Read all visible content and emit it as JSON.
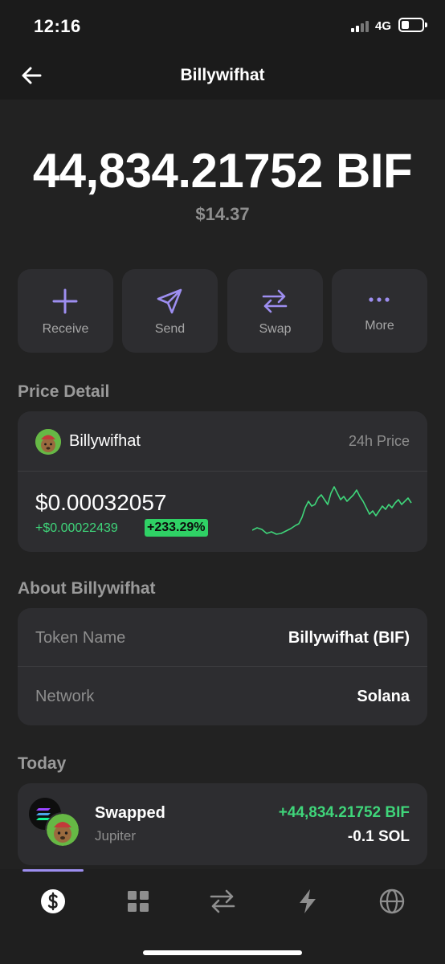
{
  "status_bar": {
    "time": "12:16",
    "network": "4G"
  },
  "header": {
    "title": "Billywifhat"
  },
  "balance": {
    "amount": "44,834.21752 BIF",
    "usd": "$14.37"
  },
  "actions": [
    {
      "label": "Receive",
      "icon": "plus-icon"
    },
    {
      "label": "Send",
      "icon": "send-icon"
    },
    {
      "label": "Swap",
      "icon": "swap-icon"
    },
    {
      "label": "More",
      "icon": "more-icon"
    }
  ],
  "price_detail": {
    "section_title": "Price Detail",
    "token_name": "Billywifhat",
    "period_label": "24h Price",
    "price": "$0.00032057",
    "change_abs": "+$0.00022439",
    "change_pct": "+233.29%"
  },
  "about": {
    "section_title": "About Billywifhat",
    "rows": [
      {
        "label": "Token Name",
        "value": "Billywifhat (BIF)"
      },
      {
        "label": "Network",
        "value": "Solana"
      }
    ]
  },
  "activity": {
    "section_title": "Today",
    "items": [
      {
        "title": "Swapped",
        "subtitle": "Jupiter",
        "amount_in": "+44,834.21752 BIF",
        "amount_out": "-0.1 SOL"
      }
    ]
  },
  "bottom_nav": {
    "items": [
      {
        "icon": "dollar-icon",
        "active": true
      },
      {
        "icon": "grid-icon",
        "active": false
      },
      {
        "icon": "swap-arrows-icon",
        "active": false
      },
      {
        "icon": "lightning-icon",
        "active": false
      },
      {
        "icon": "globe-icon",
        "active": false
      }
    ]
  },
  "colors": {
    "accent": "#9d8ef0",
    "positive": "#3fd57a",
    "background": "#222222",
    "card": "#2d2d30"
  }
}
